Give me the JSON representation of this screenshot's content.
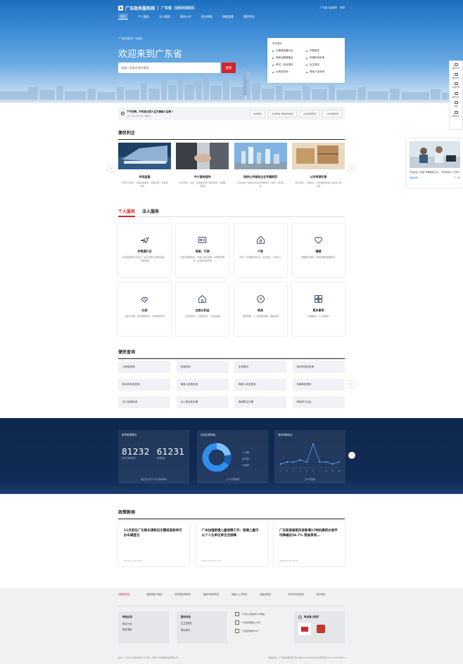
{
  "header": {
    "site_name": "广东政务服务网",
    "province": "广东省",
    "switch_label": "[切换省市区镇街道]",
    "user_links": [
      "广东省人民政府",
      "登录"
    ],
    "nav": [
      "首页",
      "个人服务",
      "法人服务",
      "政务公开",
      "阳光审批",
      "效能监督",
      "便民利企"
    ]
  },
  "hero": {
    "breadcrumb": "广东政务服务一网通办",
    "welcome": "欢迎来到广东省",
    "search_placeholder": "请输入您要办理的事项",
    "search_button": "搜索",
    "quick_title": "常用服务",
    "quick_items": [
      "办理港澳通行证",
      "护照签发",
      "驾驶证期满换证",
      "车辆年检申请",
      "考试、科目报名",
      "出生登记",
      "公积金查询",
      "残疾人证申请"
    ]
  },
  "sidebar": [
    "我的空间",
    "我的办件",
    "在线咨询",
    "我的评价",
    "投诉",
    "帮助中心"
  ],
  "notice": {
    "title": "下午好啊，开车前记得人生万事顺人生啊 !",
    "date": "2016年11月12日 星期六",
    "tags": [
      "在线预约",
      "办证查询 请您如何进行",
      "企业名称查询",
      "公共资源交易"
    ]
  },
  "float_ad": {
    "text": "开办企业一窗通“开单机网上办”，开办时间5个工作日",
    "left": "查看详情",
    "right": "下一条"
  },
  "bianmin": {
    "title": "便民利企",
    "cards": [
      {
        "title": "市场监管",
        "desc": "专项行为监管，食品药品监管，质量监督，消费者服务……"
      },
      {
        "title": "中介服务超市",
        "desc": "机关单位、企业、市民发布中介服务需求，选择服务机构"
      },
      {
        "title": "政府公共服务企业专属网页",
        "desc": "为企业统一提供企业空间专属网页，提供个性化服务"
      },
      {
        "title": "公共资源交易",
        "desc": "政府采购、工程建设、土地使用权和矿业权出让等交易"
      }
    ]
  },
  "tabs": [
    "个人服务",
    "法人服务"
  ],
  "services": [
    {
      "title": "护照通行证",
      "desc": "往来港澳通行证签注、往台湾通行证再次签注、护照签发",
      "icon": "plane-icon"
    },
    {
      "title": "驾驶、行驶",
      "desc": "驾驶证期满换证、驾驶人信息变更、车辆年检预约、补领机动车号牌",
      "icon": "id-card-icon"
    },
    {
      "title": "户政",
      "desc": "申领、补领居民身份证，出生登记，户籍迁入",
      "icon": "house-icon"
    },
    {
      "title": "婚姻",
      "desc": "婚姻登记预约，港澳台居民婚姻登记",
      "icon": "heart-icon"
    },
    {
      "title": "社保",
      "desc": "社保卡办理、医疗保险申请、养老保险申请",
      "icon": "shield-heart-icon"
    },
    {
      "title": "住房公积金",
      "desc": "公积金查询、公积金贷款、公积金提取",
      "icon": "house-home-icon"
    },
    {
      "title": "税务",
      "desc": "常用申报、个人所得税申报、纳税证明",
      "icon": "tax-icon"
    },
    {
      "title": "更多事项",
      "desc": "办理更多个人公共服务",
      "icon": "grid-icon"
    }
  ],
  "queries": {
    "title": "便民查询",
    "items": [
      "公积金查询",
      "社保查询",
      "生育登记",
      "机动车违法查询",
      "机动车状态查询",
      "驾驶人信息查询",
      "驾驶人状态查询",
      "车辆年检预约",
      "法人信息查询",
      "出入境业务办理",
      "渔港签注办理",
      "驾驶学习认证"
    ]
  },
  "dashboard": {
    "panel1_title": "事项受理情况",
    "num1": "81232",
    "num1_cap": "本年已受理事项",
    "num2": "61231",
    "num2_cap": "办结数量",
    "panel1_foot": "截止至今日下午共计受理事项",
    "panel2_title": "在线办理流量",
    "panel2_foot": "上个月流量数据",
    "legend": [
      "个人服务",
      "法人服务",
      "公共服务"
    ],
    "panel3_title": "政府网数统计",
    "panel3_foot": "近10天数据"
  },
  "chart_data": {
    "type": "line",
    "x": [
      "1",
      "2",
      "3",
      "4",
      "5",
      "6",
      "7",
      "8",
      "9",
      "10"
    ],
    "values": [
      2,
      3,
      3,
      4,
      3,
      12,
      3,
      3,
      2,
      3
    ]
  },
  "news": {
    "title": "政策新闻",
    "items": [
      {
        "title": "11月起在广东购车请税后无需纸质税单可办车辆登记",
        "date": "2016-11-01 08:07"
      },
      {
        "title": "广州加强困境儿童保障工作：困境儿童可以个人为单位享生活保障",
        "date": "2016-10-30 17:34"
      },
      {
        "title": "广东医保报销目录新增17种抗癌药价格平均降幅达56.7% 我省享保...",
        "date": "2016-10-20 09:07"
      }
    ]
  },
  "footer": {
    "links": [
      "中国政府网",
      "国务院部门网站",
      "驻粤港机构网站",
      "地级市政府网站",
      "地级以上市网站",
      "县级区网站",
      "省内专业性网站",
      "数字网站"
    ],
    "box1_title": "网站信息",
    "box1_items": [
      "网站介绍",
      "服务指南"
    ],
    "box2_title": "服务热线",
    "box2_phone": "12345",
    "box2_sub": "联系我们",
    "apps": [
      "广东省人民政府门户网站",
      "广东政务服务公众号",
      "广东政务服务APP"
    ],
    "box3_title": "粤省事小程序",
    "copyright": "主办：广东省人民政府办公厅  承办：数字广东网络建设有限公司",
    "icp": "网站标识：广东政务服务网  粤ICP备05070829号  粤公网安备44010602000604"
  }
}
